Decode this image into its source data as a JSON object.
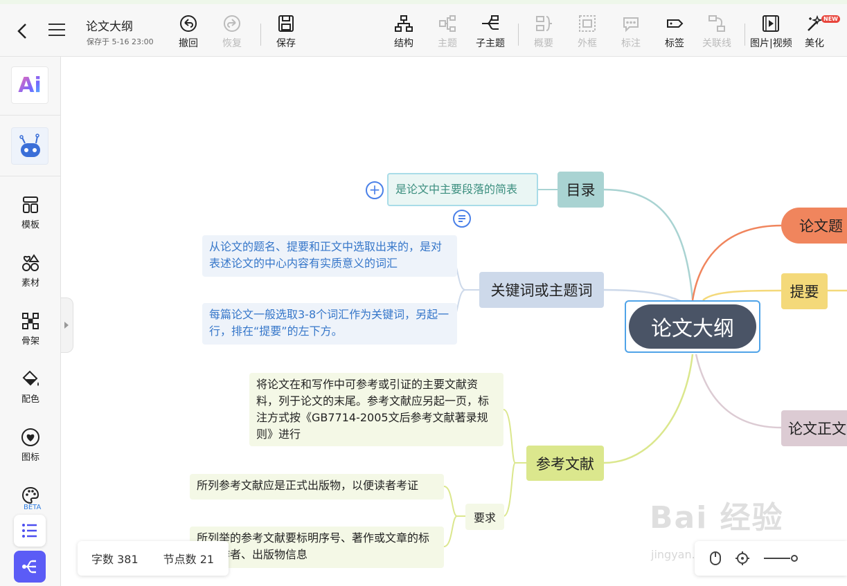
{
  "header": {
    "title": "论文大纲",
    "save_status": "保存于 5-16 23:00",
    "undo": "撤回",
    "redo": "恢复",
    "save": "保存",
    "structure": "结构",
    "topic": "主题",
    "subtopic": "子主题",
    "summary": "概要",
    "frame": "外框",
    "annotation": "标注",
    "tag": "标签",
    "relation": "关联线",
    "media": "图片|视频",
    "beautify": "美化",
    "new_badge": "NEW"
  },
  "sidebar": {
    "ai_label": "Ai",
    "items": [
      {
        "label": "模板"
      },
      {
        "label": "素材"
      },
      {
        "label": "骨架"
      },
      {
        "label": "配色"
      },
      {
        "label": "图标"
      }
    ],
    "beta": "BETA"
  },
  "mindmap": {
    "root": "论文大纲",
    "topics": {
      "toc": "目录",
      "toc_desc": "是论文中主要段落的简表",
      "keywords": "关键词或主题词",
      "kw_desc1": "从论文的题名、提要和正文中选取出来的，是对表述论文的中心内容有实质意义的词汇",
      "kw_desc2": "每篇论文一般选取3-8个词汇作为关键词，另起一行，排在“提要”的左下方。",
      "refs": "参考文献",
      "refs_desc": "将论文在和写作中可参考或引证的主要文献资料，列于论文的末尾。参考文献应另起一页，标注方式按《GB7714-2005文后参考文献著录规则》进行",
      "requirement": "要求",
      "req1": "所列参考文献应是正式出版物，以便读者考证",
      "req2": "所列举的参考文献要标明序号、著作或文章的标题、作者、出版物信息",
      "title_topic": "论文题",
      "abstract": "提要",
      "body": "论文正文"
    },
    "colors": {
      "toc": "#a9d3d2",
      "keywords": "#cdd9ea",
      "refs": "#dbe78d",
      "title_topic": "#f0855d",
      "abstract": "#f4d97a",
      "body": "#dccbd3",
      "root": "#4a5466"
    }
  },
  "status": {
    "word_count": "字数 381",
    "node_count": "节点数 21"
  },
  "watermark": {
    "main": "Bai 经验",
    "sub": "jingyan.baidu.com"
  }
}
